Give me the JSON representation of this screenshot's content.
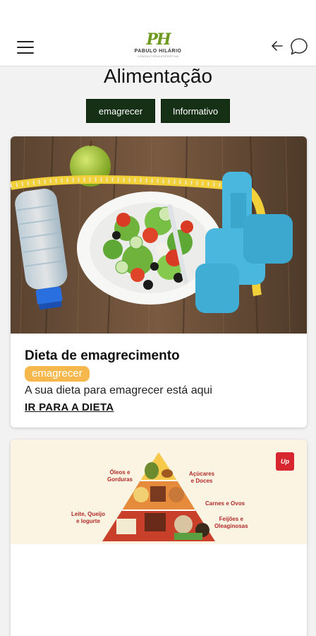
{
  "header": {
    "logo_mark": "PH",
    "logo_name": "PABULO HILÁRIO",
    "logo_sub": "CONSULTORIA ESPORTIVA",
    "menu_icon": "hamburger-menu-icon",
    "back_icon": "arrow-left-icon",
    "chat_icon": "chat-bubble-icon"
  },
  "page": {
    "title": "Alimentação"
  },
  "tags": [
    {
      "label": "emagrecer"
    },
    {
      "label": "Informativo"
    }
  ],
  "cards": [
    {
      "image": "diet-salad-dumbbells-photo",
      "title": "Dieta de emagrecimento",
      "badge": "emagrecer",
      "description": "A sua dieta para emagrecer está aqui",
      "link": "IR PARA A DIETA"
    },
    {
      "image": "food-pyramid-illustration",
      "pyramid_labels": {
        "oleos": "Óleos e",
        "oleos2": "Gorduras",
        "acucares": "Açúcares",
        "acucares2": "e Doces",
        "carnes": "Carnes e Ovos",
        "leite": "Leite, Queijo",
        "leite2": "e Iogurte",
        "feijoes": "Feijões e",
        "feijoes2": "Oleaginosas",
        "brand": "Up"
      }
    }
  ],
  "colors": {
    "tag_bg": "#163016",
    "badge_bg": "#f6b84c",
    "logo_green": "#6c9a1f"
  }
}
